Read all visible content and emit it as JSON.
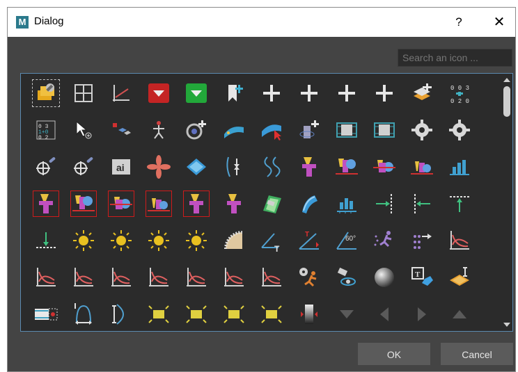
{
  "window": {
    "title": "Dialog",
    "logo": "M",
    "help": "?",
    "close": "✕"
  },
  "search": {
    "placeholder": "Search an icon ..."
  },
  "buttons": {
    "ok": "OK",
    "cancel": "Cancel"
  },
  "colors": {
    "accent_blue": "#5b8ab0",
    "dialog_bg": "#444444",
    "panel_bg": "#2b2b2b",
    "red_outline": "#d01b1b"
  },
  "icons": [
    [
      "painting-icon",
      "grid-square-icon",
      "axis-line-icon",
      "red-down-button-icon",
      "green-down-button-icon",
      "bookmark-plus-icon",
      "plus-icon",
      "plus-icon",
      "plus-icon",
      "plus-icon",
      "layers-plus-icon",
      "matrix-small-icon"
    ],
    [
      "matrix-add-icon",
      "cursor-plus-icon",
      "cubes-link-icon",
      "skeleton-icon",
      "disc-add-icon",
      "surface-point-icon",
      "surface-cursor-icon",
      "tower-add-icon",
      "film-strip-icon",
      "film-strip-icon",
      "gear-icon",
      "gear-icon"
    ],
    [
      "crosshair-link-icon",
      "crosshair-link-icon",
      "ai-icon",
      "fan-icon",
      "diamond-plane-icon",
      "flow-arrows-icon",
      "curve-wave-icon",
      "shapes-stack-icon",
      "shapes-line-icon",
      "shapes-cut-icon",
      "shapes-floor-icon",
      "bar-chart-icon"
    ],
    [
      "shapes-stack-icon",
      "shapes-line-icon",
      "shapes-cut-icon",
      "shapes-floor-icon",
      "shapes-stack-icon",
      "shapes-stack-icon",
      "surface-warp-icon",
      "surface-bend-icon",
      "bar-ruler-icon",
      "align-right-icon",
      "align-left-icon",
      "align-top-icon"
    ],
    [
      "align-bottom-icon",
      "sun-icon",
      "sun-icon",
      "sun-icon",
      "sun-icon",
      "saw-blade-icon",
      "angle-text-icon",
      "angle-marker-icon",
      "angle-60-icon",
      "run-particles-icon",
      "move-particles-icon",
      "curve-graph-icon"
    ],
    [
      "curve-graph-icon",
      "curve-graph-icon",
      "curve-graph-icon",
      "curve-graph-icon",
      "curve-graph-icon",
      "curve-graph-icon",
      "curve-graph-icon",
      "gear-runner-icon",
      "camera-rotate-icon",
      "sphere-icon",
      "text-cube-icon",
      "plane-cursor-icon"
    ],
    [
      "film-marquee-icon",
      "arc-span-icon",
      "arc-measure-icon",
      "bracket-rect-icon",
      "bracket-rect-icon",
      "bracket-rect-icon",
      "bracket-rect-icon",
      "gradient-bar-icon",
      "triangle-down-icon",
      "triangle-left-icon",
      "triangle-right-icon",
      "triangle-up-icon"
    ]
  ]
}
